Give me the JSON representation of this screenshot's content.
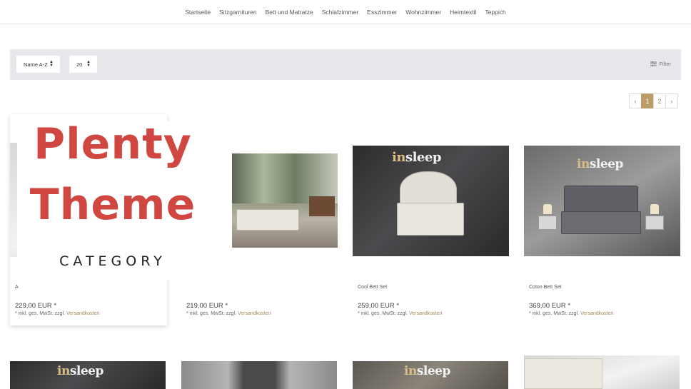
{
  "nav": {
    "items": [
      "Startseite",
      "Sitzgarnituren",
      "Bett und Matratze",
      "Schlafzimmer",
      "Esszimmer",
      "Wohnzimmer",
      "Heimtextil",
      "Teppich"
    ]
  },
  "toolbar": {
    "sort_value": "Name A-Z",
    "items_per_page": "20",
    "filter_label": "Filter"
  },
  "pagination": {
    "prev": "‹",
    "pages": [
      "1",
      "2"
    ],
    "next": "›",
    "active": "1"
  },
  "products": [
    {
      "name": "A",
      "price": "229,00 EUR *",
      "vat_text": "* inkl. ges. MwSt. zzgl. ",
      "shipping_link": "Versandkosten"
    },
    {
      "name": "",
      "price": "219,00 EUR *",
      "vat_text": "* inkl. ges. MwSt. zzgl. ",
      "shipping_link": "Versandkosten"
    },
    {
      "name": "Cool Bett Set",
      "price": "259,00 EUR *",
      "vat_text": "* inkl. ges. MwSt. zzgl. ",
      "shipping_link": "Versandkosten"
    },
    {
      "name": "Coton Bett Set",
      "price": "369,00 EUR *",
      "vat_text": "* inkl. ges. MwSt. zzgl. ",
      "shipping_link": "Versandkosten"
    }
  ],
  "brand_logo": {
    "prefix": "in",
    "suffix": "sleep"
  },
  "overlay": {
    "line1": "Plenty",
    "line2": "Theme",
    "line3": "CATEGORY"
  },
  "colors": {
    "accent": "#bd9a68",
    "overlay_red": "#cf4740",
    "toolbar_bg": "#e6e8ec"
  },
  "icons": {
    "filter": "filter-icon",
    "sort": "sort-arrows-icon",
    "prev": "chevron-left-icon",
    "next": "chevron-right-icon"
  }
}
